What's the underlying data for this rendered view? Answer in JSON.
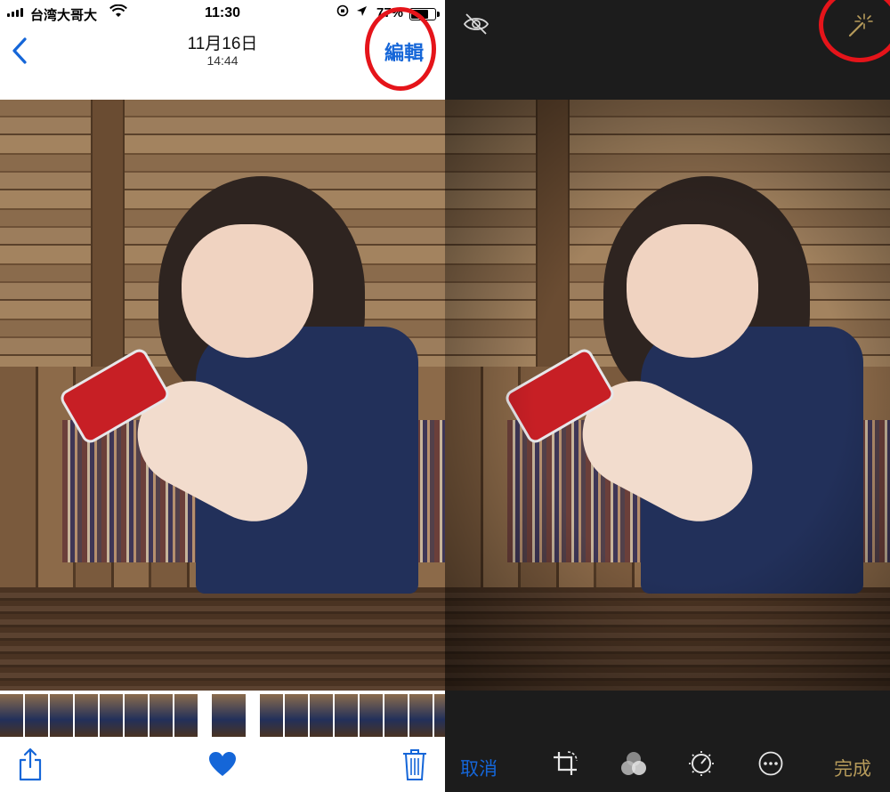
{
  "status_bar": {
    "carrier": "台湾大哥大",
    "time": "11:30",
    "battery_percent": "77%",
    "battery_level": 0.77
  },
  "left_screen": {
    "nav": {
      "back_icon": "chevron-left-icon",
      "date": "11月16日",
      "time": "14:44",
      "edit_label": "編輯"
    },
    "thumbnail_count_left": 8,
    "thumbnail_count_right": 8,
    "toolbar": {
      "share_icon": "share-icon",
      "favorite_icon": "heart-icon",
      "delete_icon": "trash-icon"
    },
    "colors": {
      "accent": "#1566d8",
      "annotation": "#e5141a"
    }
  },
  "right_screen": {
    "top_bar": {
      "hide_icon": "eye-slash-icon",
      "auto_enhance_icon": "magic-wand-icon"
    },
    "bottom_bar": {
      "cancel_label": "取消",
      "done_label": "完成",
      "icons": [
        "crop-rotate-icon",
        "filters-icon",
        "adjust-dial-icon",
        "more-icon"
      ]
    },
    "colors": {
      "background": "#1c1c1c",
      "done": "#b59a5a"
    }
  }
}
